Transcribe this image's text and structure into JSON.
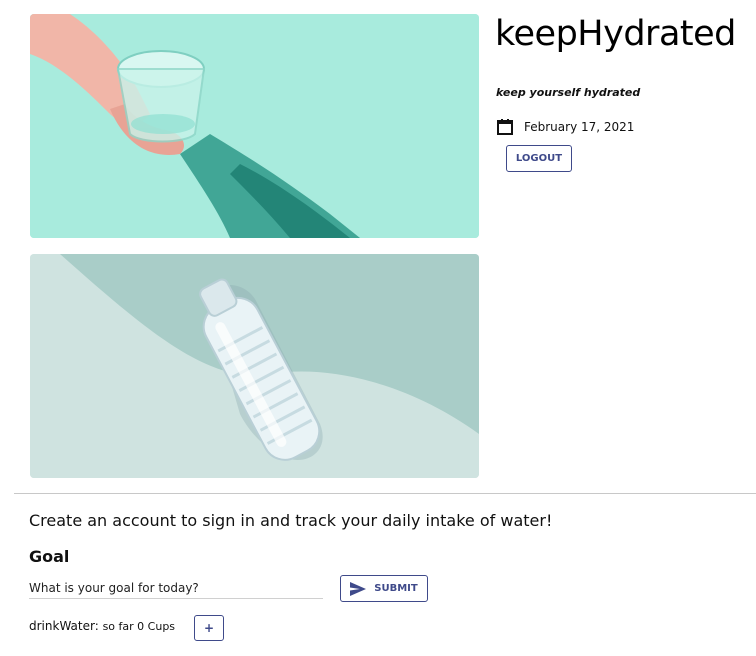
{
  "header": {
    "title": "keepHydrated",
    "tagline": "keep yourself hydrated",
    "date": "February 17, 2021",
    "logout_label": "LOGOUT"
  },
  "images": [
    {
      "name": "hand-holding-glass-photo"
    },
    {
      "name": "water-bottle-photo"
    }
  ],
  "main": {
    "intro": "Create an account to sign in and track your daily intake of water!",
    "goal_heading": "Goal",
    "goal_placeholder": "What is your goal for today?",
    "submit_label": "SUBMIT",
    "drink_label": "drinkWater:",
    "drink_count": "so far 0 Cups",
    "add_label": "+"
  },
  "colors": {
    "accent": "#3f4a8a",
    "glass_bg": "#a6e9dc",
    "bottle_bg": "#cfe4e1"
  },
  "icons": [
    "calendar-icon",
    "send-icon"
  ]
}
